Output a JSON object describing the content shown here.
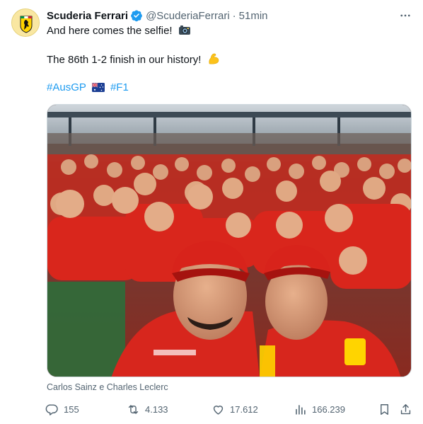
{
  "author": {
    "display_name": "Scuderia Ferrari",
    "handle": "@ScuderiaFerrari",
    "separator": "·",
    "timestamp": "51min",
    "avatar_icon": "ferrari-shield-icon",
    "verified_icon": "verified-badge-icon"
  },
  "tweet": {
    "line1": "And here comes the selfie!",
    "line1_emoji": "camera-flash-emoji",
    "line2": "The 86th 1-2 finish in our history!",
    "line2_emoji": "flexed-biceps-emoji",
    "hashtag1": "#AusGP",
    "flag_emoji": "australia-flag-emoji",
    "hashtag2": "#F1"
  },
  "media": {
    "icon": "photo-selfie-image"
  },
  "caption": "Carlos Sainz e Charles Leclerc",
  "actions": {
    "replies": "155",
    "retweets": "4.133",
    "likes": "17.612",
    "views": "166.239"
  },
  "colors": {
    "link": "#1d9bf0",
    "secondary_text": "#536471",
    "primary_text": "#0f1419",
    "ferrari_red": "#d40000",
    "ferrari_yellow": "#ffd700"
  }
}
